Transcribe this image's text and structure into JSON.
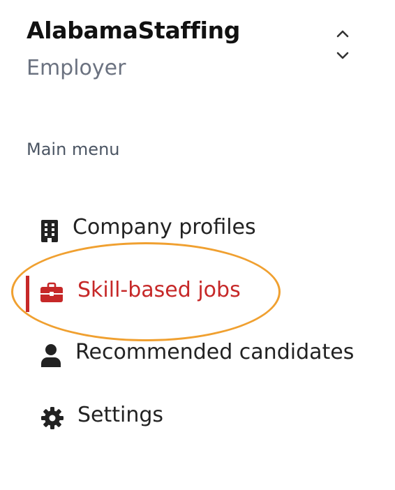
{
  "org": {
    "name": "AlabamaStaffing",
    "role": "Employer"
  },
  "menu": {
    "section_label": "Main menu",
    "items": [
      {
        "label": "Company profiles",
        "icon": "building-icon",
        "active": false
      },
      {
        "label": "Skill-based jobs",
        "icon": "briefcase-icon",
        "active": true
      },
      {
        "label": "Recommended candidates",
        "icon": "user-icon",
        "active": false
      },
      {
        "label": "Settings",
        "icon": "gear-icon",
        "active": false
      }
    ]
  },
  "colors": {
    "active": "#c62828",
    "highlight_ring": "#f0a030",
    "muted_text": "#6b7280",
    "text": "#222222"
  }
}
